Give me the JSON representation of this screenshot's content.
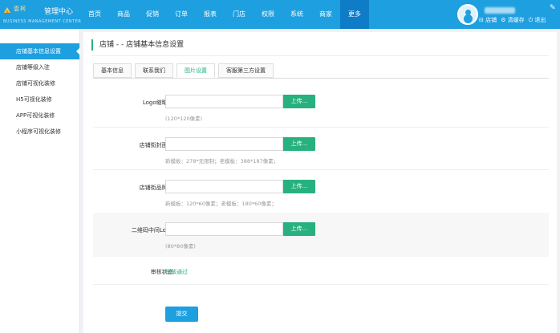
{
  "header": {
    "brand": "壹柯",
    "title": "管理中心",
    "subtitle": "BUSINESS MANAGEMENT CENTER",
    "nav": [
      "首页",
      "商品",
      "促销",
      "订单",
      "报表",
      "门店",
      "权限",
      "系统",
      "商家",
      "更多"
    ],
    "active_nav": "更多",
    "user_actions": {
      "store": "店铺",
      "clear_cache": "清缓存",
      "logout": "退出"
    },
    "accent_color": "#1e9fe0"
  },
  "sidebar": {
    "items": [
      {
        "label": "店铺基本信息设置",
        "active": true
      },
      {
        "label": "店铺等级入驻",
        "active": false
      },
      {
        "label": "店铺可视化装修",
        "active": false
      },
      {
        "label": "H5可视化装修",
        "active": false
      },
      {
        "label": "APP可视化装修",
        "active": false
      },
      {
        "label": "小程序可视化装修",
        "active": false
      }
    ]
  },
  "main": {
    "title": "店铺 - - 店铺基本信息设置",
    "tabs": [
      {
        "label": "基本信息",
        "active": false
      },
      {
        "label": "联系我们",
        "active": false
      },
      {
        "label": "图片设置",
        "active": true
      },
      {
        "label": "客服第三方设置",
        "active": false
      }
    ],
    "fields": [
      {
        "label": "Logo缩略图:",
        "value": "",
        "button": "上传...",
        "hint": "(120*120像素)"
      },
      {
        "label": "店铺街封面图:",
        "value": "",
        "button": "上传...",
        "hint": "新模板：278*无限制；老模板：388*187像素；"
      },
      {
        "label": "店铺街品牌图:",
        "value": "",
        "button": "上传...",
        "hint": "新模板：120*60像素；老模板：180*60像素；"
      },
      {
        "label": "二维码中间Logo:",
        "value": "",
        "button": "上传...",
        "hint": "(80*80像素)"
      }
    ],
    "review": {
      "label": "审核状态:",
      "value": "审核通过"
    },
    "submit_label": "提交",
    "success_color": "#27b17f"
  }
}
